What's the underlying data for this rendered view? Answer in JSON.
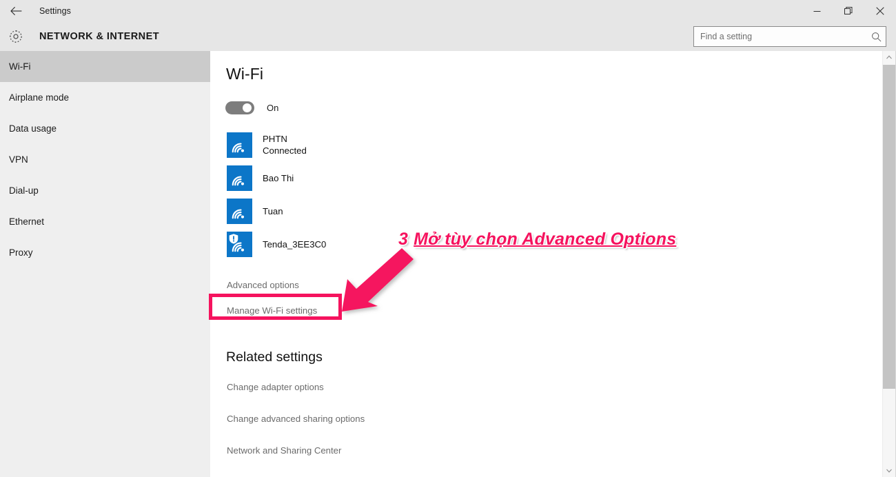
{
  "window": {
    "app_title": "Settings",
    "back_icon": "back-arrow-icon",
    "minimize_label": "—",
    "restore_label": "❐",
    "close_label": "✕"
  },
  "header": {
    "gear_icon": "gear-icon",
    "page_title": "NETWORK & INTERNET",
    "search": {
      "placeholder": "Find a setting",
      "value": "",
      "icon": "search-icon"
    }
  },
  "sidebar": {
    "items": [
      {
        "label": "Wi-Fi",
        "selected": true
      },
      {
        "label": "Airplane mode",
        "selected": false
      },
      {
        "label": "Data usage",
        "selected": false
      },
      {
        "label": "VPN",
        "selected": false
      },
      {
        "label": "Dial-up",
        "selected": false
      },
      {
        "label": "Ethernet",
        "selected": false
      },
      {
        "label": "Proxy",
        "selected": false
      }
    ]
  },
  "main": {
    "heading": "Wi-Fi",
    "toggle": {
      "state_label": "On",
      "checked": true
    },
    "networks": [
      {
        "name": "PHTN",
        "status": "Connected",
        "secure_warning": false,
        "icon": "wifi-signal-icon"
      },
      {
        "name": "Bao Thi",
        "status": "",
        "secure_warning": false,
        "icon": "wifi-signal-icon"
      },
      {
        "name": "Tuan",
        "status": "",
        "secure_warning": false,
        "icon": "wifi-signal-icon"
      },
      {
        "name": "Tenda_3EE3C0",
        "status": "",
        "secure_warning": true,
        "icon": "wifi-signal-warning-icon"
      }
    ],
    "advanced_options_label": "Advanced options",
    "manage_wifi_label": "Manage Wi-Fi settings",
    "related": {
      "heading": "Related settings",
      "links": [
        "Change adapter options",
        "Change advanced sharing options",
        "Network and Sharing Center"
      ]
    }
  },
  "scrollbar": {
    "up_icon": "scroll-up-arrow-icon",
    "down_icon": "scroll-down-arrow-icon"
  },
  "annotation": {
    "step_number": "3",
    "text": "Mở tùy chọn Advanced Options",
    "color": "#f5135e",
    "arrow_icon": "annotation-arrow-icon",
    "highlight_target": "Advanced options"
  },
  "colors": {
    "accent_blue": "#0c76c8",
    "chrome_gray": "#e6e6e6",
    "sidebar_gray": "#efefef",
    "selected_gray": "#cbcbcb",
    "annotation_pink": "#f5135e"
  }
}
